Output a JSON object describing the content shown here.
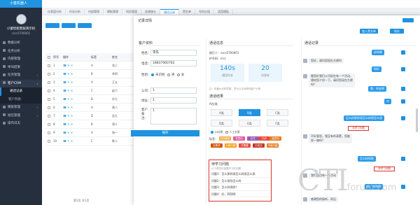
{
  "app": {
    "logo": "小蜜机器人",
    "robot_name": "小蜜智能客服演示机",
    "username": "cscs5700001"
  },
  "sidebar": {
    "items": [
      {
        "label": "数据分析",
        "arrow": ""
      },
      {
        "label": "任务分析",
        "arrow": ""
      },
      {
        "label": "内部管理",
        "arrow": ""
      },
      {
        "label": "呼叫结果",
        "arrow": ""
      },
      {
        "label": "任务管理",
        "arrow": "‹"
      },
      {
        "label": "客户CRM",
        "arrow": "‹"
      },
      {
        "label": "通话记录",
        "arrow": ""
      },
      {
        "label": "客户列表",
        "arrow": ""
      },
      {
        "label": "模板管理",
        "arrow": "‹"
      },
      {
        "label": "短信管理",
        "arrow": "‹"
      },
      {
        "label": "操作日志",
        "arrow": ""
      }
    ]
  },
  "tabs": [
    {
      "label": "仪表盘分析"
    },
    {
      "label": "任务分析"
    },
    {
      "label": "内部管理"
    },
    {
      "label": "模板管理"
    },
    {
      "label": "短信管理"
    },
    {
      "label": "坐席统计"
    },
    {
      "label": "通话记录"
    },
    {
      "label": "黑名单"
    },
    {
      "label": "号码分组"
    },
    {
      "label": "语音模板"
    }
  ],
  "background_table": {
    "headers": [
      "序号",
      "操作",
      "标签",
      "姓名"
    ],
    "rows": [
      {
        "no": "1",
        "tag": "A",
        "name": "张三"
      },
      {
        "no": "2",
        "tag": "B",
        "name": "李四"
      },
      {
        "no": "3",
        "tag": "A",
        "name": "王五"
      },
      {
        "no": "4",
        "tag": "C",
        "name": "赵六"
      },
      {
        "no": "5",
        "tag": "B",
        "name": "孙七"
      },
      {
        "no": "6",
        "tag": "A",
        "name": "周八"
      },
      {
        "no": "7",
        "tag": "D",
        "name": "吴九"
      },
      {
        "no": "8",
        "tag": "B",
        "name": "郑十"
      },
      {
        "no": "9",
        "tag": "A",
        "name": "钱一"
      },
      {
        "no": "10",
        "tag": "C",
        "name": "陈二"
      }
    ],
    "footer": "第1页 共1页"
  },
  "modal": {
    "title": "记录详情",
    "join_blacklist_button": "加入黑名单",
    "save_button": "保存",
    "customer": {
      "section_title": "客户资料",
      "name_label": "姓名：",
      "name_value": "李先",
      "phone_label": "电话：",
      "phone_value": "18837060762",
      "gender_label": "性别：",
      "gender_options": [
        "未识别",
        "男",
        "女"
      ],
      "company_label": "公司：",
      "company_value": "1",
      "address_label": "地址：",
      "address_value": "1",
      "remark_label": "客户备注：",
      "remark_value": "1",
      "submit_button": "保存"
    },
    "call": {
      "section_title": "通话信息",
      "caller": "拨打人：cscs5700001",
      "caller_no": "护号码：/ccc",
      "duration_value": "140s",
      "duration_label": "通话时长",
      "rounds_value": "20",
      "rounds_label": "问答轮",
      "result_title": "通话结果",
      "note": "注：机器AI识别意图，您可以手动修改客户分类",
      "intent_title": "AI分类",
      "intents": [
        {
          "label": "A类",
          "active": false
        },
        {
          "label": "B类",
          "active": true
        },
        {
          "label": "C类",
          "active": false
        },
        {
          "label": "D类",
          "active": false
        },
        {
          "label": "E类",
          "active": false
        },
        {
          "label": "F类",
          "active": false
        }
      ],
      "mode_options": [
        "AI分类",
        "人工分类"
      ],
      "tags_label": "标签：",
      "tags": [
        {
          "label": "已加微信",
          "color": "#f0ad4e"
        },
        {
          "label": "有意向",
          "color": "#e25aa0"
        },
        {
          "label": "在忙",
          "color": "#9b59b6"
        },
        {
          "label": "已约",
          "color": "#e74c3c"
        },
        {
          "label": "高意向",
          "color": "#e67e22"
        },
        {
          "label": "没需求",
          "color": "#d35400"
        },
        {
          "label": "价格问题",
          "color": "#f39c12"
        },
        {
          "label": "不需要",
          "color": "#e74c3c"
        },
        {
          "label": "已成交",
          "color": "#c0392b"
        },
        {
          "label": "不感兴趣",
          "color": "#e67e22"
        }
      ]
    },
    "learning": {
      "title": "待学习问题",
      "subtitle": "以下是您可能要学习的问题",
      "items": [
        "问题1：怎么那样保怎么样保怎么保",
        "问题2：怎么保你怎么样",
        "问题3：怎么样保呢？",
        "问题4：好，拜拜啊"
      ]
    },
    "chat": {
      "section_title": "通话记录",
      "bubbles": [
        {
          "side": "r",
          "text": "好的嗯"
        },
        {
          "side": "l",
          "text": "您好，请问您现在方便吗"
        },
        {
          "side": "r",
          "text": "你好"
        },
        {
          "side": "l",
          "text": "看您好我们公司现在有一个活动，想给您介绍一下，请问您现在方便吗？"
        },
        {
          "side": "r",
          "text": "嗯，你说吧"
        },
        {
          "side": "r",
          "text": "对"
        },
        {
          "side": "r",
          "text": "怎么样那样保怎么样保怎么保"
        },
        {
          "side": "l",
          "text": "不好意思，我没有听清楚，您能说一遍吗？"
        },
        {
          "side": "r",
          "text": "怎么样保呢"
        },
        {
          "side": "l",
          "text": "我们这边有一个活动"
        },
        {
          "side": "r",
          "text": "好，拜拜啊"
        },
        {
          "side": "l",
          "text": "感谢您的接听，再见"
        }
      ],
      "learn_tags": [
        "待学习问题",
        "待学习问题"
      ]
    }
  },
  "watermark": {
    "big": "CTI",
    "small": "forum.com"
  }
}
